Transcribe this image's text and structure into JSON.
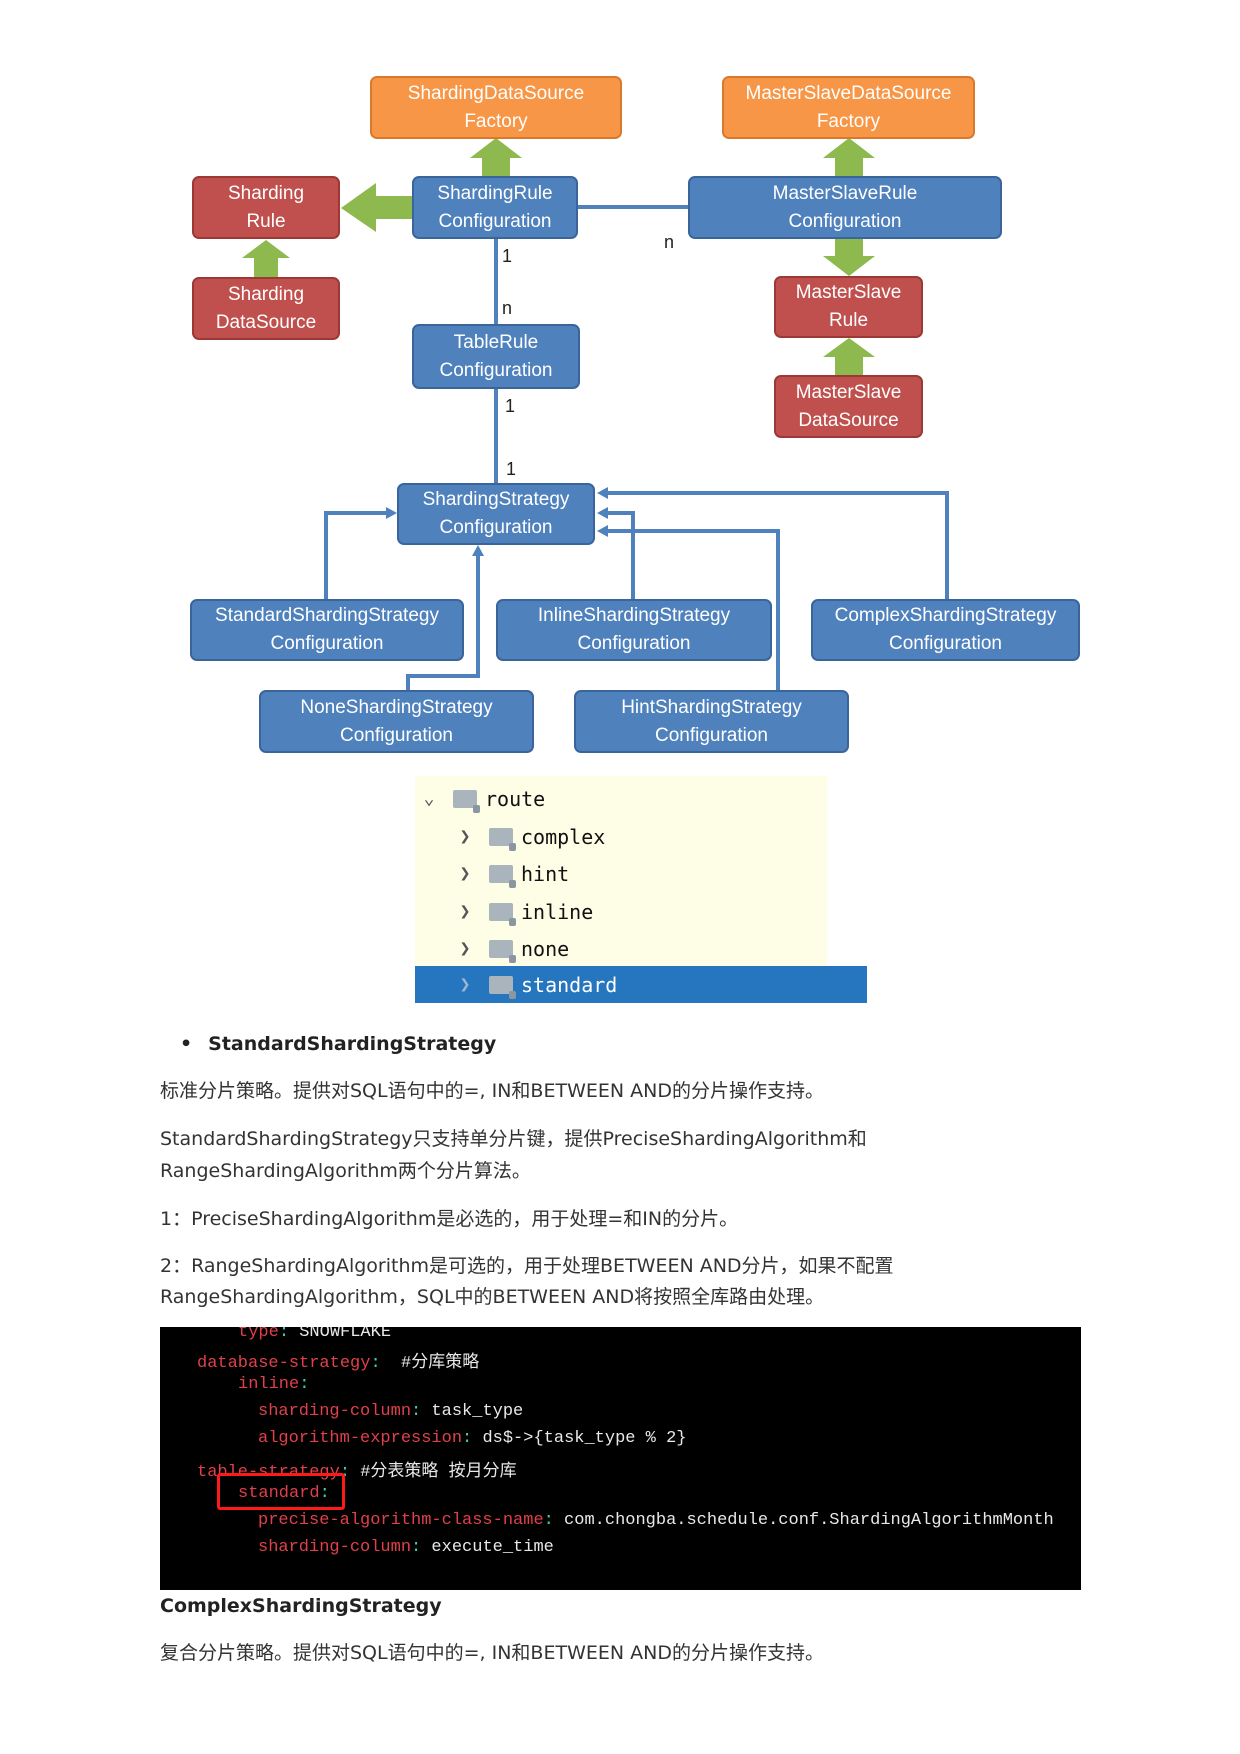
{
  "diagram": {
    "sharding_ds_factory": [
      "ShardingDataSource",
      "Factory"
    ],
    "masterslave_ds_factory": [
      "MasterSlaveDataSource",
      "Factory"
    ],
    "sharding_rule": [
      "Sharding",
      "Rule"
    ],
    "sharding_rule_config": [
      "ShardingRule",
      "Configuration"
    ],
    "masterslave_rule_config": [
      "MasterSlaveRule",
      "Configuration"
    ],
    "sharding_datasource": [
      "Sharding",
      "DataSource"
    ],
    "masterslave_rule": [
      "MasterSlave",
      "Rule"
    ],
    "table_rule_config": [
      "TableRule",
      "Configuration"
    ],
    "masterslave_datasource": [
      "MasterSlave",
      "DataSource"
    ],
    "sharding_strategy_config": [
      "ShardingStrategy",
      "Configuration"
    ],
    "standard": [
      "StandardShardingStrategy",
      "Configuration"
    ],
    "inline": [
      "InlineShardingStrategy",
      "Configuration"
    ],
    "complex": [
      "ComplexShardingStrategy",
      "Configuration"
    ],
    "none": [
      "NoneShardingStrategy",
      "Configuration"
    ],
    "hint": [
      "HintShardingStrategy",
      "Configuration"
    ],
    "labels": {
      "a": "1",
      "b": "n",
      "c": "1",
      "d": "1",
      "e": "n"
    },
    "colors": {
      "orange": "#f79646",
      "red": "#c0504d",
      "blue": "#4f81bd",
      "green": "#8db94e"
    }
  },
  "tree": {
    "root": "route",
    "children": [
      "complex",
      "hint",
      "inline",
      "none",
      "standard"
    ],
    "selected": "standard"
  },
  "content": {
    "bullet": "StandardShardingStrategy",
    "p1": "标准分片策略。提供对SQL语句中的=, IN和BETWEEN AND的分片操作支持。",
    "p2a": "StandardShardingStrategy只支持单分片键，提供PreciseShardingAlgorithm和",
    "p2b": "RangeShardingAlgorithm两个分片算法。",
    "p3": "1：PreciseShardingAlgorithm是必选的，用于处理=和IN的分片。",
    "p4a": "2：RangeShardingAlgorithm是可选的，用于处理BETWEEN AND分片，如果不配置",
    "p4b": "RangeShardingAlgorithm，SQL中的BETWEEN AND将按照全库路由处理。",
    "heading2": "ComplexShardingStrategy",
    "p5": "复合分片策略。提供对SQL语句中的=, IN和BETWEEN AND的分片操作支持。"
  },
  "code": {
    "l1k": "type",
    "l1v": " SNOWFLAKE",
    "l2k": "database-strategy",
    "l2v": "  #分库策略",
    "l3k": "inline",
    "l4k": "sharding-column",
    "l4v": " task_type",
    "l5k": "algorithm-expression",
    "l5v": " ds$->{task_type % 2}",
    "l6k": "table-strategy",
    "l6v": " #分表策略 按月分库",
    "l7k": "standard",
    "l8k": "precise-algorithm-class-name",
    "l8v": " com.chongba.schedule.conf.ShardingAlgorithmMonth",
    "l9k": "sharding-column",
    "l9v": " execute_time",
    "colon": ":"
  }
}
